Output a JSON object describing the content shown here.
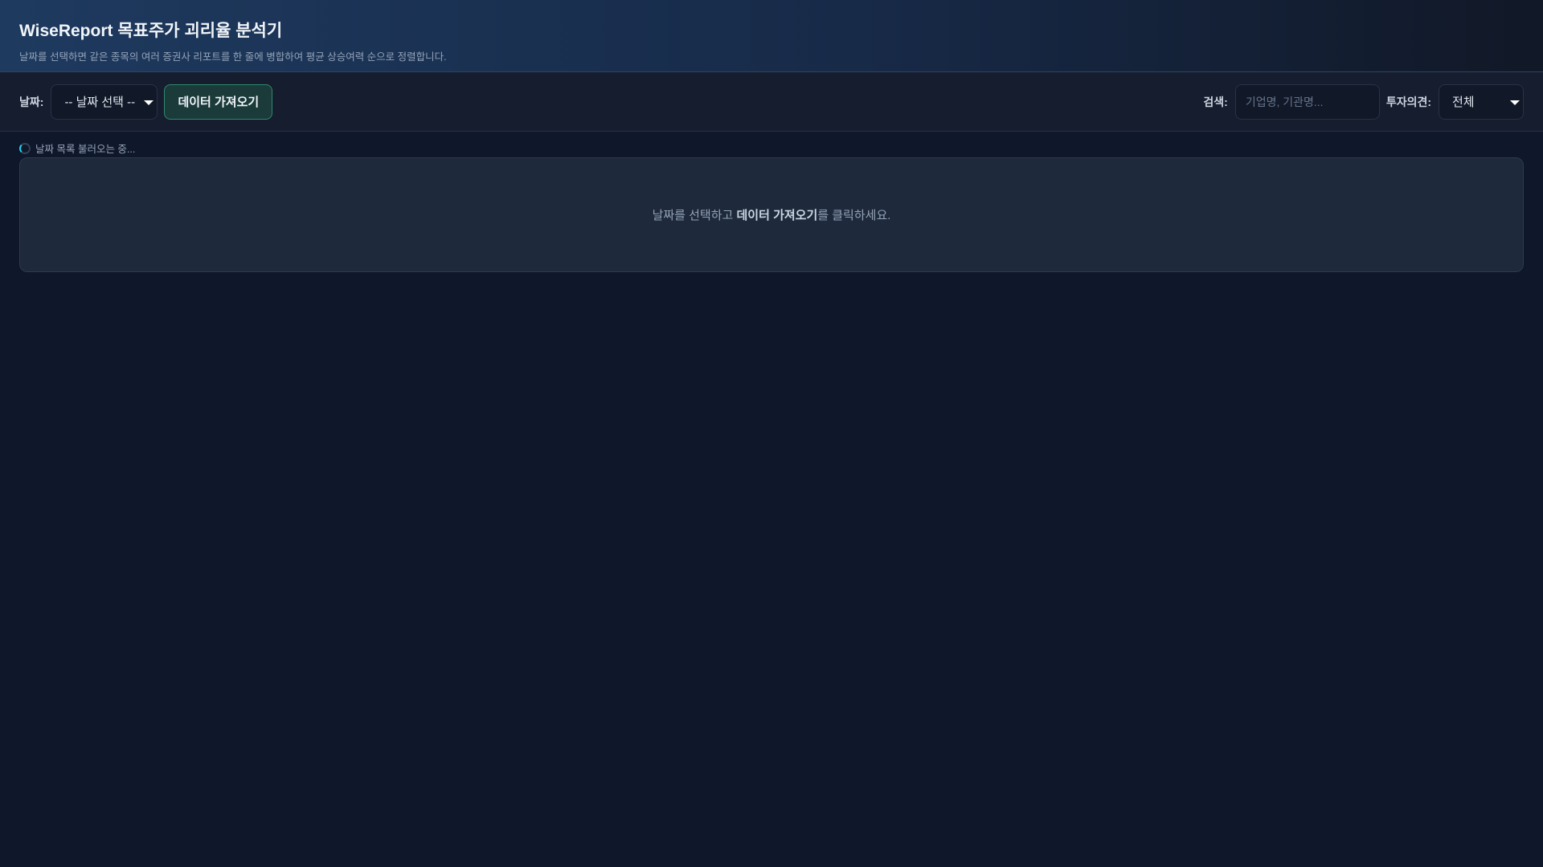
{
  "header": {
    "title": "WiseReport 목표주가 괴리율 분석기",
    "subtitle": "날짜를 선택하면 같은 종목의 여러 증권사 리포트를 한 줄에 병합하여 평균 상승여력 순으로 정렬합니다."
  },
  "toolbar": {
    "date_label": "날짜:",
    "date_select": "-- 날짜 선택 --",
    "fetch_button": "데이터 가져오기",
    "search_label": "검색:",
    "search_placeholder": "기업명, 기관명...",
    "opinion_label": "투자의견:",
    "opinion_select": "전체"
  },
  "status": {
    "text": "날짜 목록 불러오는 중..."
  },
  "panel": {
    "before": "날짜를 선택하고 ",
    "bold": "데이터 가져오기",
    "after": "를 클릭하세요."
  }
}
